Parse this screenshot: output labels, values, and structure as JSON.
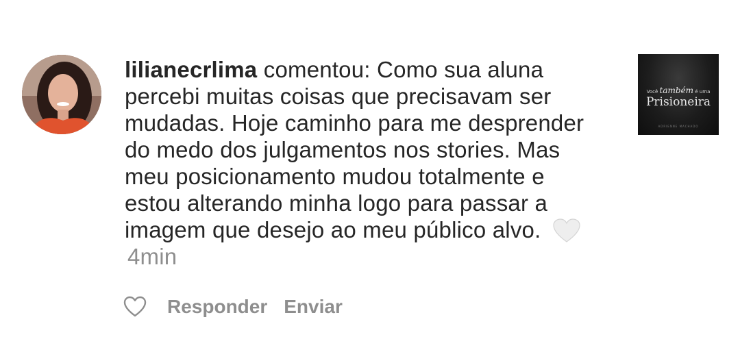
{
  "comment": {
    "username": "lilianecrlima",
    "verb": "comentou:",
    "text": "Como sua aluna percebi muitas coisas que precisavam ser mudadas. Hoje caminho para me desprender do medo dos julgamentos nos stories. Mas meu posicionamento mudou totalmente e estou alterando minha logo para passar a imagem que desejo ao meu público alvo.",
    "time": "4min",
    "heart_icon": "heart-emoji-white"
  },
  "post_thumbnail": {
    "line1_prefix": "Você",
    "line1_cursive": "também",
    "line1_suffix": "é uma",
    "line2": "Prisioneira",
    "footer": "ADRIENNE MACHADO"
  },
  "actions": {
    "like_icon": "heart-outline-icon",
    "reply_label": "Responder",
    "send_label": "Enviar"
  },
  "colors": {
    "text": "#262626",
    "muted": "#8e8e8e",
    "background": "#ffffff"
  }
}
